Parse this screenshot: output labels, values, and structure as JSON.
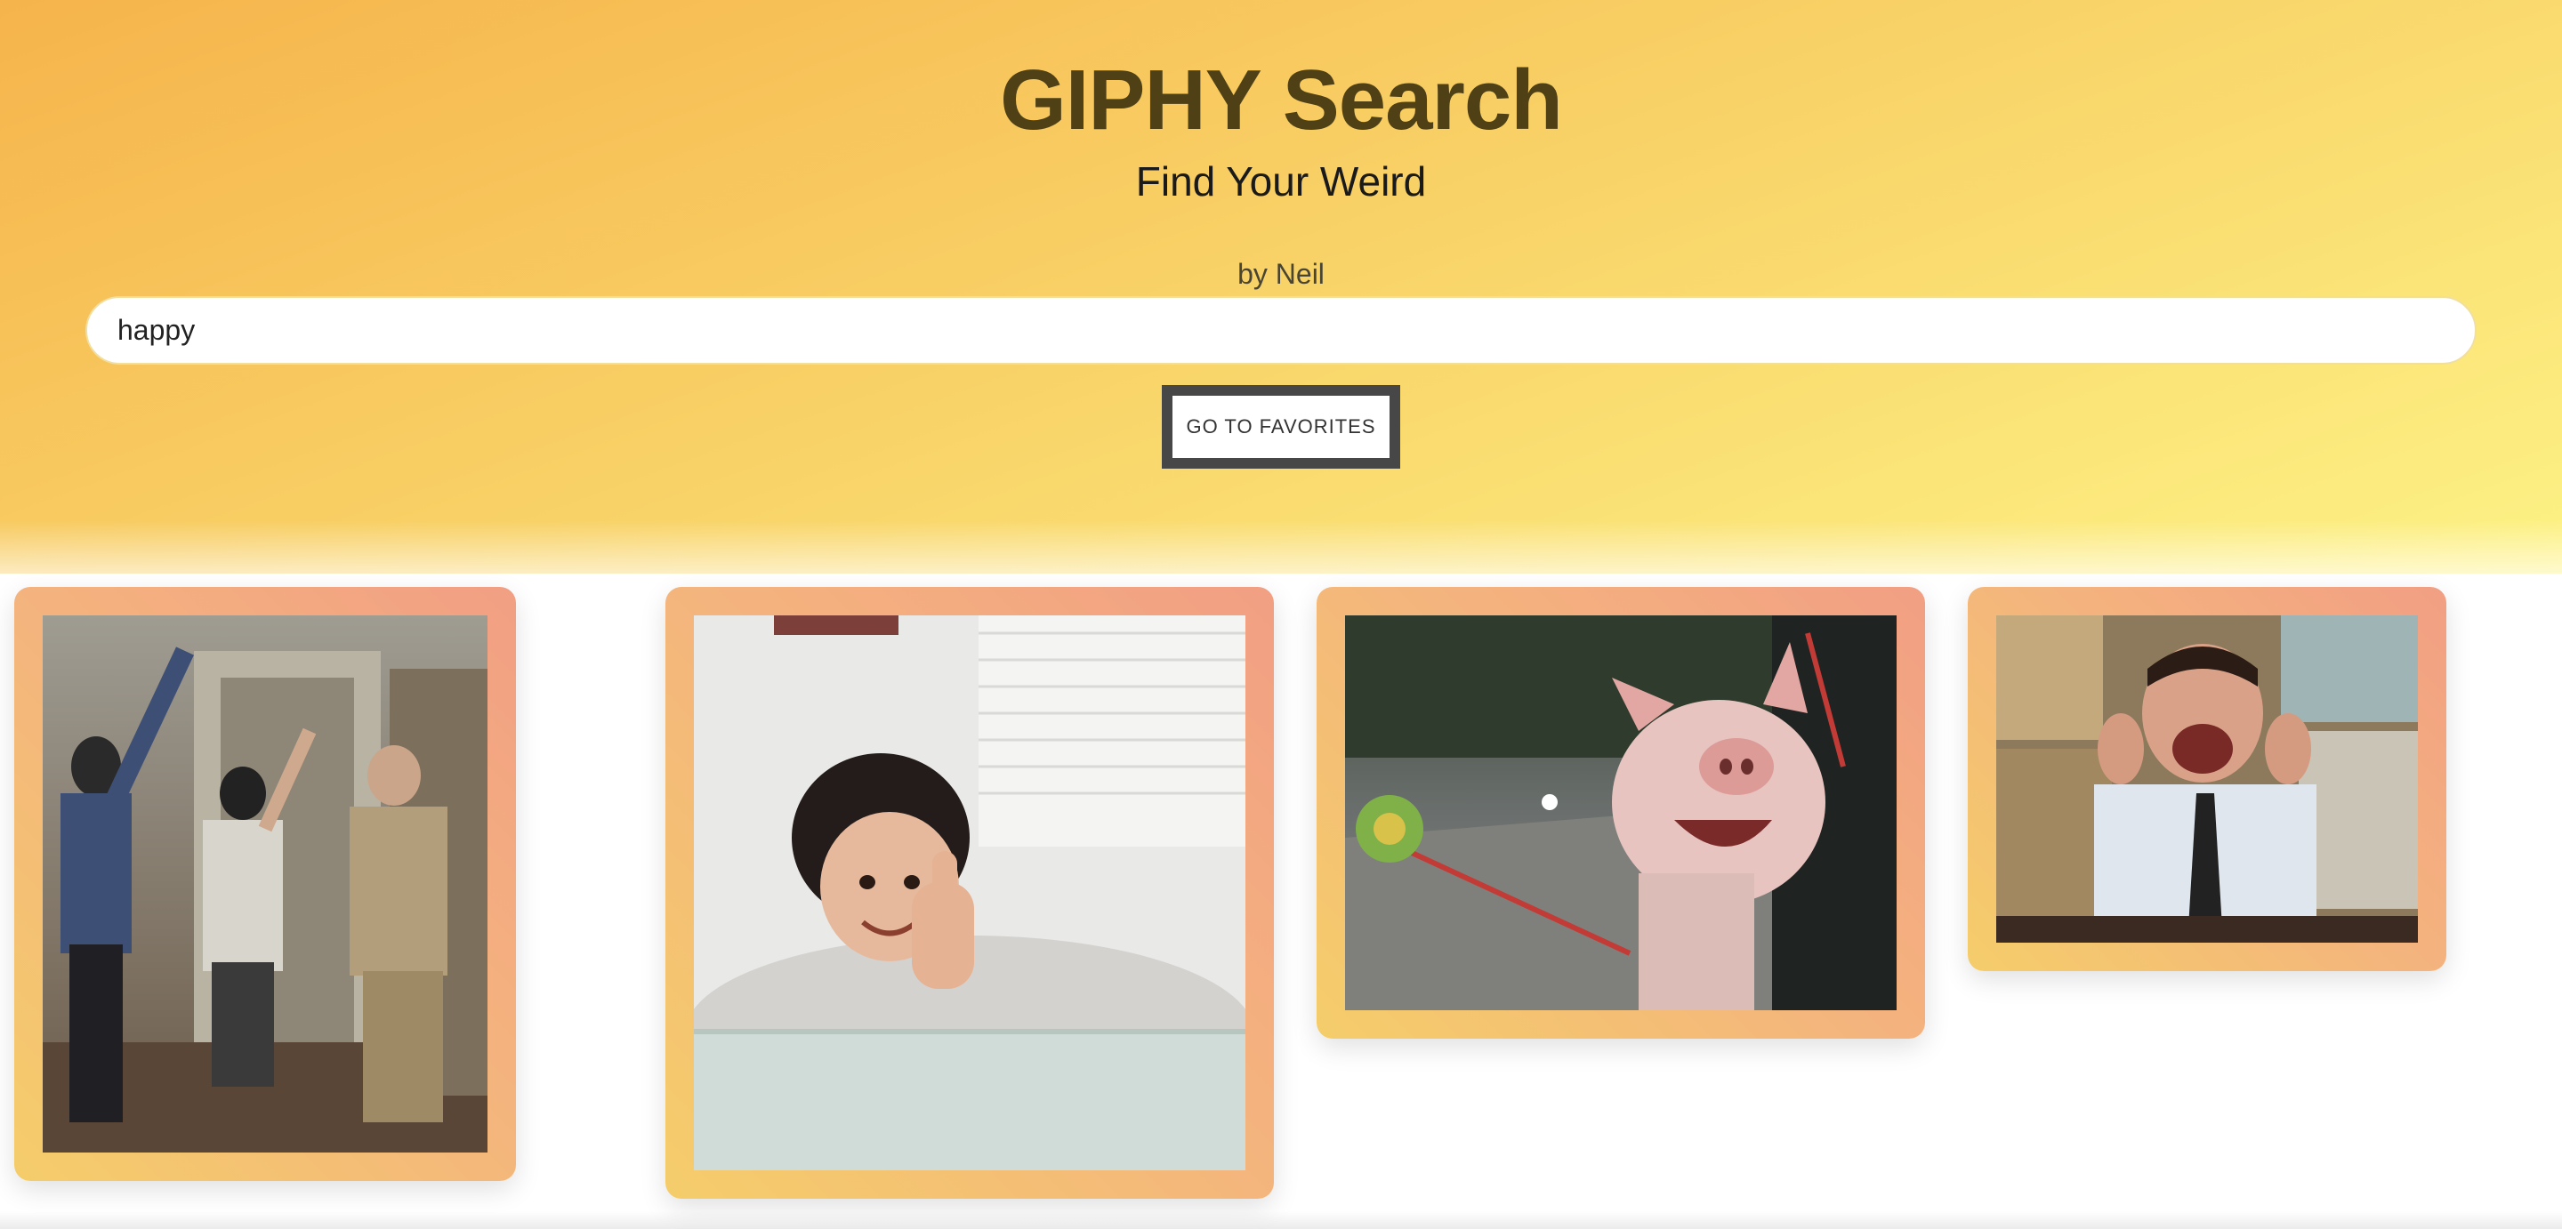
{
  "header": {
    "title": "GIPHY Search",
    "subtitle": "Find Your Weird",
    "byline": "by Neil"
  },
  "search": {
    "value": "happy"
  },
  "favorites_button": {
    "label": "GO TO FAVORITES"
  },
  "colors": {
    "header_start": "#f6b44c",
    "header_end": "#fdf285",
    "title": "#4f4016",
    "card_gradient_start": "#f5cd6a",
    "card_gradient_end": "#f29f83",
    "button_border": "#474747"
  },
  "results": [
    {
      "subject": "people-dancing-in-apartment-gif"
    },
    {
      "subject": "toddler-thumbs-up-gif"
    },
    {
      "subject": "pig-in-car-window-gif"
    },
    {
      "subject": "man-clapping-excited-gif"
    }
  ]
}
